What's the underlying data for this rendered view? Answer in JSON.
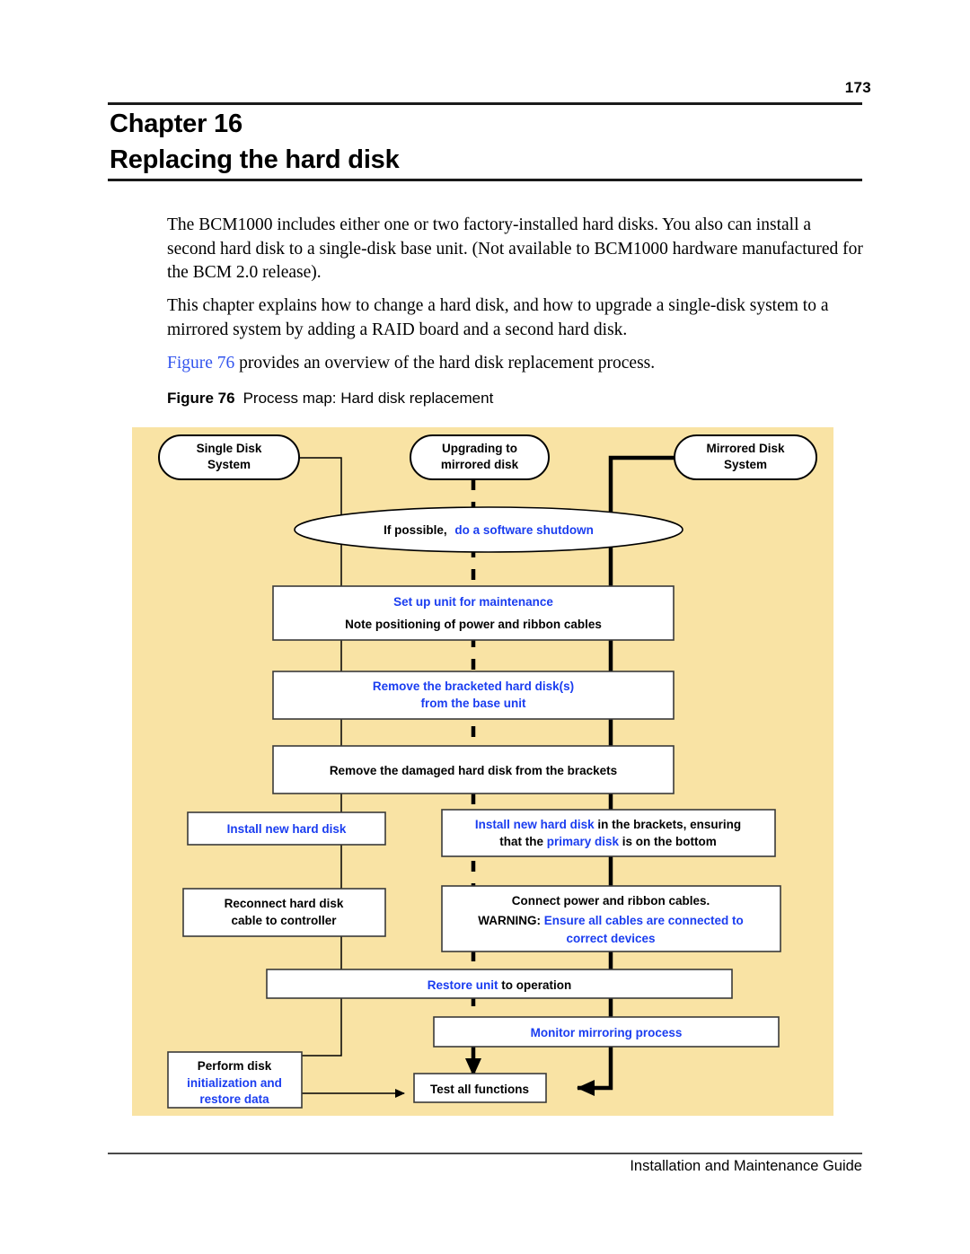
{
  "page": {
    "number": "173",
    "footer": "Installation and Maintenance Guide"
  },
  "heading": {
    "chapter_label": "Chapter 16",
    "chapter_title": "Replacing the hard disk"
  },
  "paragraphs": {
    "p1": "The BCM1000 includes either one or two factory-installed hard disks. You also can install a second hard disk to a single-disk base unit. (Not available to BCM1000 hardware manufactured for the BCM 2.0 release).",
    "p2": "This chapter explains how to change a hard disk, and how to upgrade a single-disk system to a mirrored system by adding a RAID board and a second hard disk.",
    "p3_link": "Figure 76",
    "p3_rest": " provides an overview of the hard disk replacement process."
  },
  "figure": {
    "caption_number": "Figure 76",
    "caption_text": "Process map: Hard disk replacement",
    "background_color": "#F9E3A4",
    "accent_color": "#1A3DF0",
    "nodes": {
      "single_disk_system": {
        "line1": "Single Disk",
        "line2": "System"
      },
      "upgrading_to_mirrored": {
        "line1": "Upgrading to",
        "line2": "mirrored disk"
      },
      "mirrored_disk_system": {
        "line1": "Mirrored Disk",
        "line2": "System"
      },
      "software_shutdown": {
        "plain": "If possible,",
        "blue": "do a software shutdown"
      },
      "setup_unit": {
        "blue": "Set up unit for maintenance",
        "plain": "Note positioning of power and ribbon cables"
      },
      "remove_bracketed": {
        "blue_line1": "Remove the bracketed hard disk(s)",
        "blue_line2": "from the base unit"
      },
      "remove_damaged": {
        "plain": "Remove the damaged hard disk from the brackets"
      },
      "install_new_left": {
        "blue": "Install new hard disk"
      },
      "install_new_right": {
        "blue1": "Install new hard disk",
        "plain1": " in the brackets, ensuring",
        "plain2": "that the ",
        "blue2": "primary disk",
        "plain3": " is on the bottom"
      },
      "reconnect_cable": {
        "line1": "Reconnect hard disk",
        "line2": "cable to controller"
      },
      "connect_power": {
        "plain1": "Connect power and ribbon cables.",
        "plain2": "WARNING:",
        "blue1": " Ensure all cables are connected to",
        "blue2": "correct devices"
      },
      "restore_unit": {
        "blue": "Restore unit",
        "plain": " to operation"
      },
      "monitor_mirroring": {
        "blue": "Monitor mirroring process"
      },
      "perform_disk": {
        "plain": "Perform disk",
        "blue1": "initialization and",
        "blue2": "restore data"
      },
      "test_all": {
        "plain": "Test all functions"
      }
    }
  }
}
